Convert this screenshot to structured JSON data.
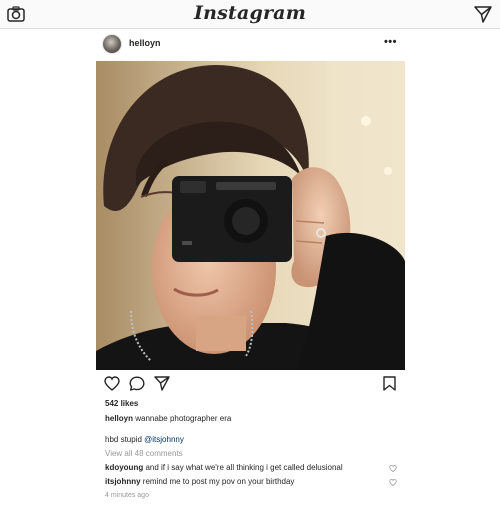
{
  "app": {
    "brand": "Instagram"
  },
  "topbar": {
    "camera_icon": "camera-icon",
    "direct_icon": "paper-plane-icon"
  },
  "post": {
    "username": "helloyn",
    "more_label": "•••",
    "likes": "542 likes",
    "caption_user": "helloyn",
    "caption_text": "wannabe photographer era",
    "comment_pre": "hbd stupid ",
    "comment_mention": "@itsjohnny",
    "view_all": "View all 48 comments",
    "comments": [
      {
        "user": "kdoyoung",
        "text": "and if i say what we're all thinking i get called delusional"
      },
      {
        "user": "itsjohnny",
        "text": "remind me to post my pov on your birthday"
      }
    ],
    "timestamp": "4 minutes ago"
  },
  "colors": {
    "text": "#262626",
    "muted": "#999999",
    "mention": "#003569",
    "border": "#dbdbdb"
  }
}
